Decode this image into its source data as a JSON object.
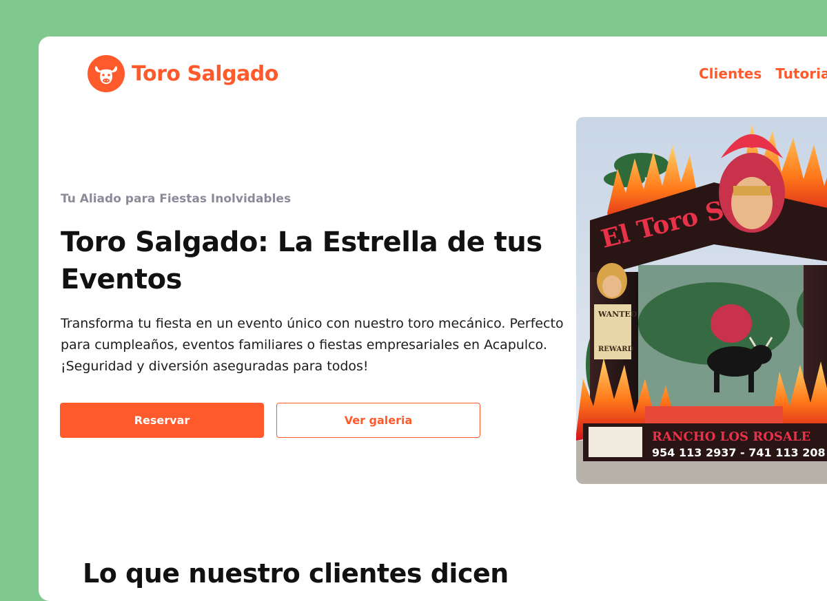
{
  "brand": {
    "name": "Toro Salgado",
    "icon": "bull-head-icon",
    "color": "#ff5a2c"
  },
  "nav": {
    "items": [
      {
        "label": "Clientes"
      },
      {
        "label": "Tutorial"
      }
    ]
  },
  "hero": {
    "eyebrow": "Tu Aliado para Fiestas Inolvidables",
    "title": "Toro Salgado: La Estrella de tus Eventos",
    "description": "Transforma tu fiesta en un evento único con nuestro toro mecánico. Perfecto para cumpleaños, eventos familiares o fiestas empresariales en Acapulco. ¡Seguridad y diversión aseguradas para todos!",
    "primary_button": "Reservar",
    "secondary_button": "Ver galeria",
    "image": {
      "banner_text": "El Toro Sa",
      "wanted_text": "WANTED",
      "reward_text": "REWARD",
      "ranch_text": "RANCHO LOS ROSALE",
      "phones_text": "954 113 2937 - 741 113 208"
    }
  },
  "testimonials": {
    "title": "Lo que nuestro clientes dicen"
  },
  "colors": {
    "background": "#80c98e",
    "accent": "#ff5a2c",
    "card": "#ffffff"
  }
}
